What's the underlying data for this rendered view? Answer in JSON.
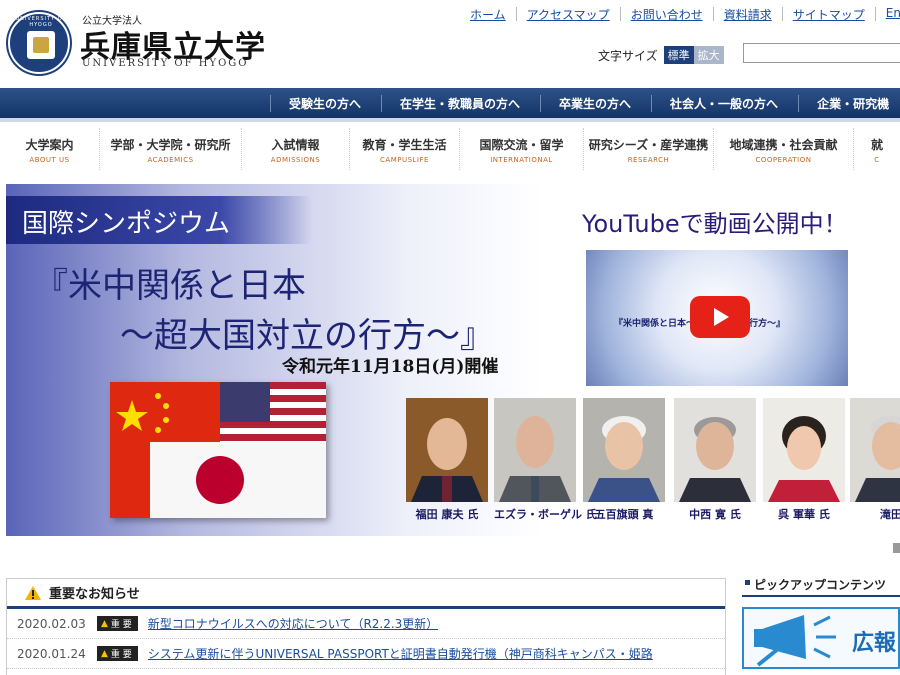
{
  "header": {
    "corp_label": "公立大学法人",
    "university_name": "兵庫県立大学",
    "university_name_en": "UNIVERSITY OF HYOGO",
    "seal_text": "UNIVERSITY OF HYOGO",
    "util_links": [
      "ホーム",
      "アクセスマップ",
      "お問い合わせ",
      "資料請求",
      "サイトマップ",
      "English"
    ],
    "font_size_label": "文字サイズ",
    "font_size_options": [
      "標準",
      "拡大"
    ],
    "search_value": ""
  },
  "audience_nav": [
    "受験生の方へ",
    "在学生・教職員の方へ",
    "卒業生の方へ",
    "社会人・一般の方へ",
    "企業・研究機"
  ],
  "main_nav": [
    {
      "ja": "大学案内",
      "en": "ABOUT US"
    },
    {
      "ja": "学部・大学院・研究所",
      "en": "ACADEMICS"
    },
    {
      "ja": "入試情報",
      "en": "ADMISSIONS"
    },
    {
      "ja": "教育・学生生活",
      "en": "CAMPUSLIFE"
    },
    {
      "ja": "国際交流・留学",
      "en": "INTERNATIONAL"
    },
    {
      "ja": "研究シーズ・産学連携",
      "en": "RESEARCH"
    },
    {
      "ja": "地域連携・社会貢献",
      "en": "COOPERATION"
    },
    {
      "ja": "就",
      "en": "C"
    }
  ],
  "banner": {
    "tag": "国際シンポジウム",
    "title_line1": "『米中関係と日本",
    "title_line2": "～超大国対立の行方～』",
    "date": "令和元年11月18日(月)開催",
    "youtube_heading": "YouTubeで動画公開中！",
    "video_caption": "『米中関係と日本～超大国対立の行方～』",
    "speakers": [
      "福田 康夫 氏",
      "エズラ・ボーゲル 氏",
      "五百旗頭 真",
      "中西 寛 氏",
      "呉 軍華 氏",
      "滝田"
    ]
  },
  "news": {
    "heading": "重要なお知らせ",
    "badge_label": "重 要",
    "items": [
      {
        "date": "2020.02.03",
        "text": "新型コロナウイルスへの対応について（R2.2.3更新）"
      },
      {
        "date": "2020.01.24",
        "text": "システム更新に伴うUNIVERSAL PASSPORTと証明書自動発行機（神戸商科キャンパス・姫路"
      }
    ]
  },
  "pickup": {
    "heading": "ピックアップコンテンツ",
    "card_label": "広報"
  },
  "colors": {
    "navy": "#1d3f7c",
    "link": "#1a4d9c",
    "nav_en": "#c8641e",
    "youtube_red": "#e62117"
  }
}
